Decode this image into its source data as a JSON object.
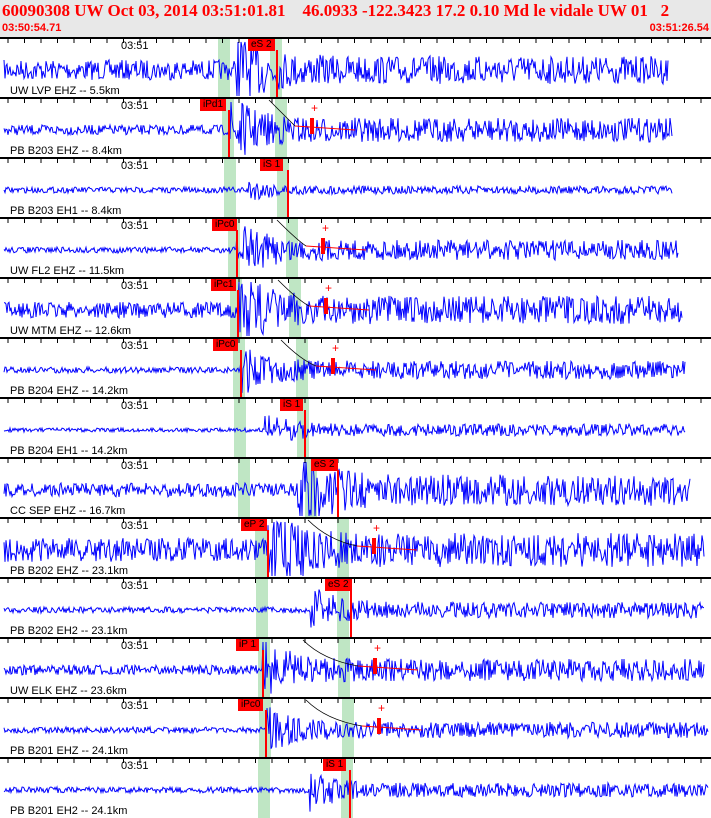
{
  "header": {
    "title": "60090308 UW Oct 03, 2014 03:51:01.81    46.0933 -122.3423 17.2 0.10 Md le vidale UW 01   2",
    "start_time": "03:50:54.71",
    "end_time": "03:51:26.54"
  },
  "colors": {
    "trace": "#0000ff",
    "pick": "#ff0000",
    "band": "#bfe6c4",
    "header_text": "#ff0000"
  },
  "traces": [
    {
      "label": "UW LVP EHZ -- 5.5km",
      "time": "03:51",
      "pick": "eS 2"
    },
    {
      "label": "PB B203 EHZ -- 8.4km",
      "time": "03:51",
      "pick": "iPd1"
    },
    {
      "label": "PB B203 EH1 -- 8.4km",
      "time": "03:51",
      "pick": "iS 1"
    },
    {
      "label": "UW FL2 EHZ -- 11.5km",
      "time": "03:51",
      "pick": "iPc0"
    },
    {
      "label": "UW MTM EHZ -- 12.6km",
      "time": "03:51",
      "pick": "iPc1"
    },
    {
      "label": "PB B204 EHZ -- 14.2km",
      "time": "03:51",
      "pick": "iPc0"
    },
    {
      "label": "PB B204 EH1 -- 14.2km",
      "time": "03:51",
      "pick": "iS 1"
    },
    {
      "label": "CC SEP EHZ -- 16.7km",
      "time": "03:51",
      "pick": "eS 2"
    },
    {
      "label": "PB B202 EHZ -- 23.1km",
      "time": "03:51",
      "pick": "eP 2"
    },
    {
      "label": "PB B202 EH2 -- 23.1km",
      "time": "03:51",
      "pick": "eS 2"
    },
    {
      "label": "UW ELK EHZ -- 23.6km",
      "time": "03:51",
      "pick": "iP 1"
    },
    {
      "label": "PB B201 EHZ -- 24.1km",
      "time": "03:51",
      "pick": "iPc0"
    },
    {
      "label": "PB B201 EH2 -- 24.1km",
      "time": "03:51",
      "pick": "iS 1"
    }
  ]
}
